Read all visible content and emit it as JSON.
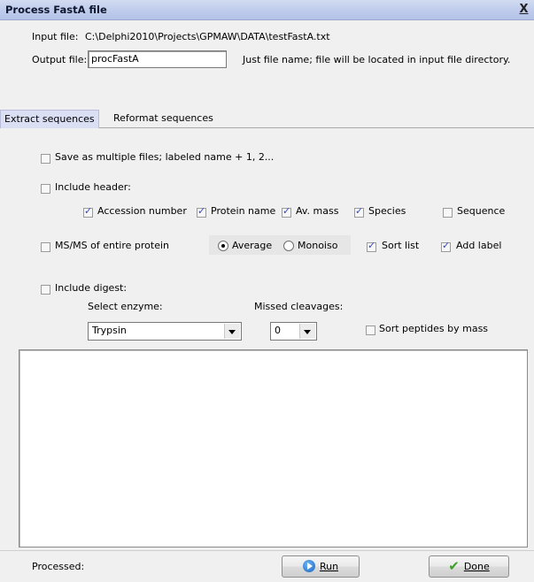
{
  "window": {
    "title": "Process FastA file",
    "close_label": "X"
  },
  "file": {
    "input_label": "Input file:",
    "input_path": "C:\\Delphi2010\\Projects\\GPMAW\\DATA\\testFastA.txt",
    "output_label": "Output file:",
    "output_value": "procFastA",
    "output_hint": "Just file name; file will be located in input file directory."
  },
  "tabs": [
    {
      "label": "Extract sequences",
      "active": true
    },
    {
      "label": "Reformat sequences",
      "active": false
    }
  ],
  "options": {
    "multiple_files": {
      "label": "Save as multiple files; labeled name + 1, 2...",
      "checked": false
    },
    "include_header": {
      "label": "Include header:",
      "checked": false
    },
    "header_fields": [
      {
        "label": "Accession number",
        "checked": true
      },
      {
        "label": "Protein name",
        "checked": true
      },
      {
        "label": "Av. mass",
        "checked": true
      },
      {
        "label": "Species",
        "checked": true
      },
      {
        "label": "Sequence",
        "checked": false
      }
    ],
    "msms": {
      "label": "MS/MS of entire protein",
      "checked": false
    },
    "mass_mode": [
      {
        "label": "Average",
        "selected": true
      },
      {
        "label": "Monoiso",
        "selected": false
      }
    ],
    "sort_list": {
      "label": "Sort list",
      "checked": true
    },
    "add_label": {
      "label": "Add label",
      "checked": true
    },
    "include_digest": {
      "label": "Include digest:",
      "checked": false
    },
    "enzyme_label": "Select enzyme:",
    "enzyme_value": "Trypsin",
    "missed_label": "Missed cleavages:",
    "missed_value": "0",
    "sort_peptides": {
      "label": "Sort peptides by mass",
      "checked": false
    }
  },
  "status": {
    "processed_label": "Processed:",
    "run_label": "Run",
    "done_label": "Done"
  }
}
